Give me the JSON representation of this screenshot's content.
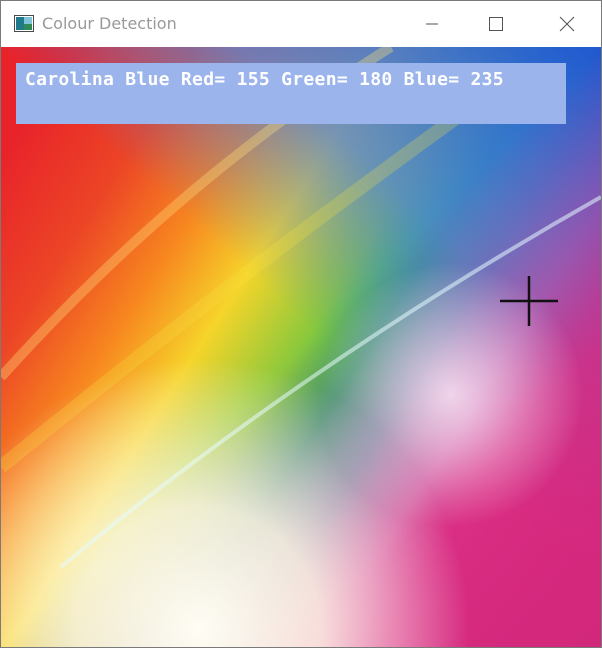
{
  "window": {
    "title": "Colour Detection",
    "controls": {
      "minimize": "minimize-icon",
      "maximize": "maximize-icon",
      "close": "close-icon"
    }
  },
  "detection": {
    "color_name": "Carolina Blue",
    "red": 155,
    "green": 180,
    "blue": 235,
    "readout": "Carolina Blue Red= 155 Green= 180 Blue= 235",
    "swatch_color": "#9BB4EB"
  },
  "image": {
    "description_colors": [
      "#E8232A",
      "#F6D42A",
      "#1BB36C",
      "#2A64D2",
      "#D9287F"
    ]
  },
  "cursor": {
    "icon": "crosshair-icon"
  }
}
